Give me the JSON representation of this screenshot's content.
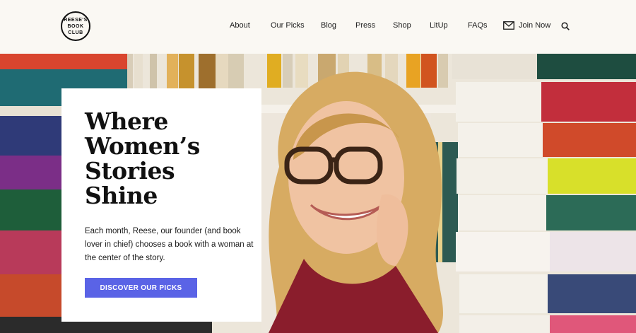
{
  "logo": {
    "line1": "REESE'S",
    "line2": "BOOK",
    "line3": "CLUB"
  },
  "nav": {
    "items": [
      {
        "label": "About"
      },
      {
        "label": "Our Picks"
      },
      {
        "label": "Blog"
      },
      {
        "label": "Press"
      },
      {
        "label": "Shop"
      },
      {
        "label": "LitUp"
      },
      {
        "label": "FAQs"
      }
    ],
    "join_label": "Join Now",
    "join_icon": "envelope-icon",
    "search_icon": "search-icon"
  },
  "hero": {
    "title_lines": [
      "Where",
      "Women’s",
      "Stories",
      "Shine"
    ],
    "body": "Each month, Reese, our founder (and book lover in chief) chooses a book with a woman at the center of the story.",
    "cta_label": "DISCOVER OUR PICKS"
  },
  "colors": {
    "accent": "#5a63e6",
    "background": "#faf8f3"
  }
}
